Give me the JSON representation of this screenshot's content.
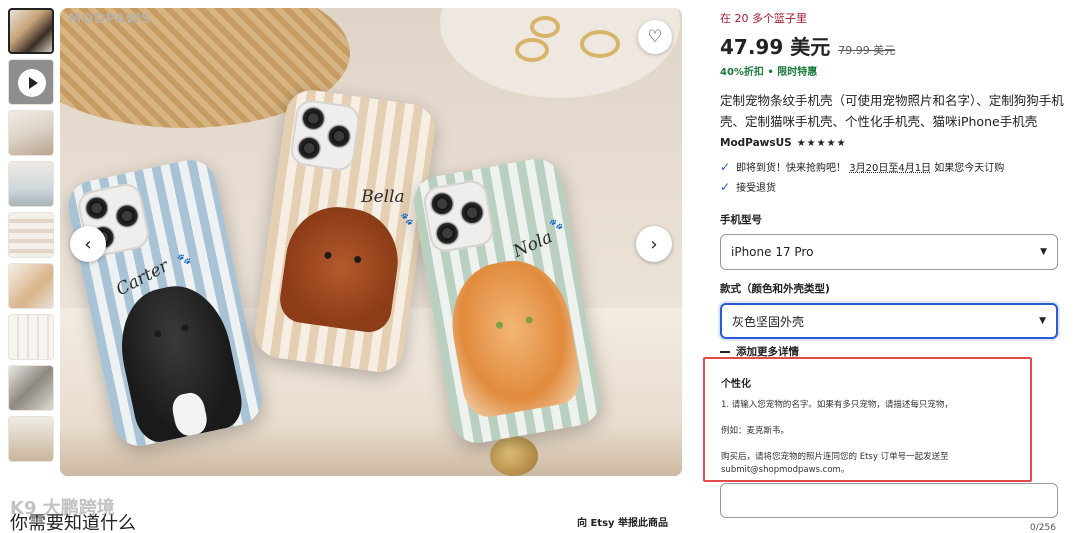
{
  "gallery": {
    "watermark": "MODPAWS",
    "thumbnails": [
      "thumb-1",
      "thumb-2-video",
      "thumb-3",
      "thumb-4",
      "thumb-5",
      "thumb-6",
      "thumb-7",
      "thumb-8",
      "thumb-9"
    ],
    "pets": [
      {
        "name": "Carter"
      },
      {
        "name": "Bella"
      },
      {
        "name": "Nola"
      }
    ],
    "prev_icon": "‹",
    "next_icon": "›",
    "favorite_icon": "♡"
  },
  "bottom": {
    "know_title": "你需要知道什么",
    "overlay_logo": "K9 大鹏跨境",
    "report_link": "向 Etsy 举报此商品"
  },
  "product": {
    "basket_notice": "在 20 多个篮子里",
    "price": "47.99 美元",
    "old_price": "79.99 美元",
    "discount": "40%折扣 • 限时特惠",
    "title": "定制宠物条纹手机壳（可使用宠物照片和名字）、定制狗狗手机壳、定制猫咪手机壳、个性化手机壳、猫咪iPhone手机壳",
    "shop_name": "ModPawsUS",
    "stars": "★★★★★",
    "delivery_prefix": "即将到货！快来抢购吧！",
    "delivery_dates": "3月20日至4月1日",
    "delivery_suffix": "如果您今天订购",
    "returns": "接受退货",
    "check_icon": "✓"
  },
  "options": {
    "model_label": "手机型号",
    "model_value": "iPhone 17 Pro",
    "style_label": "款式（颜色和外壳类型)",
    "style_value": "灰色坚固外壳",
    "caret_icon": "▼",
    "add_details": "添加更多详情"
  },
  "personalization": {
    "title": "个性化",
    "line1": "1. 请输入您宠物的名字。如果有多只宠物，请描述每只宠物，",
    "line2": "例如：麦克斯韦。",
    "line3": "购买后，请将您宠物的照片连同您的 Etsy 订单号一起发送至",
    "line4": "submit@shopmodpaws.com。",
    "counter": "0/256"
  },
  "colors": {
    "accent_blue": "#2a5bd7",
    "discount_green": "#1a7a3c",
    "basket_red": "#a61a2e",
    "highlight_box": "#e24b4b"
  }
}
